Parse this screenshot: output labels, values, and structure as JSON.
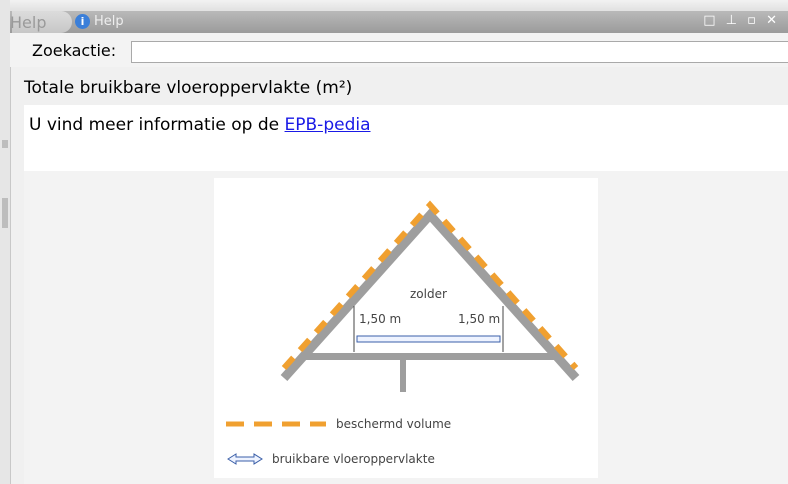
{
  "window": {
    "tab_label": "Help",
    "title": "Help",
    "controls": "□ ⊥ ▫ ✕"
  },
  "search": {
    "label": "Zoekactie:",
    "value": "",
    "placeholder": ""
  },
  "page": {
    "heading": "Totale bruikbare vloeroppervlakte (m²)",
    "info_prefix": "U vind meer informatie op de ",
    "info_link": "EPB-pedia "
  },
  "illustration": {
    "room_label": "zolder",
    "left_dim": "1,50 m",
    "right_dim": "1,50 m",
    "legend": [
      {
        "icon": "dashed-orange-line",
        "label": "beschermd volume"
      },
      {
        "icon": "double-arrow",
        "label": "bruikbare vloeroppervlakte"
      }
    ]
  },
  "colors": {
    "roof": "#9e9e9e",
    "protected_volume": "#f0a030",
    "link": "#1a1ae6"
  }
}
